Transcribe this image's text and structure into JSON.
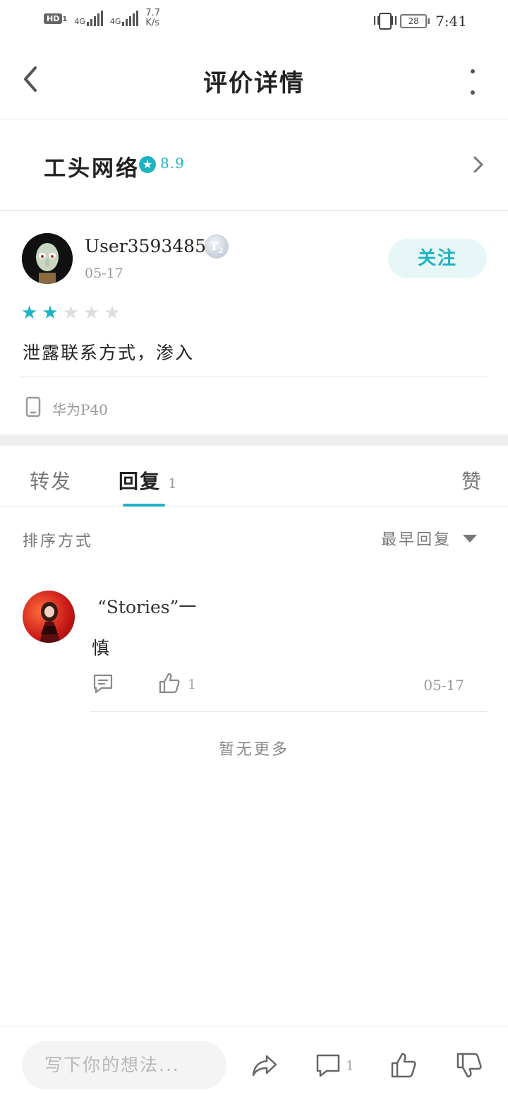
{
  "status_bar": {
    "hd": "HD",
    "hd_sub": "1",
    "net1": "4G",
    "net2": "4G",
    "speed_value": "7.7",
    "speed_unit": "K/s",
    "battery": "28",
    "time": "7:41"
  },
  "header": {
    "title": "评价详情"
  },
  "app": {
    "name": "工头网络",
    "score": "8.9"
  },
  "review": {
    "username": "User35934854",
    "level": "T",
    "level_sub": "2",
    "date": "05-17",
    "follow_label": "关注",
    "stars_filled": 2,
    "stars_total": 5,
    "text": "泄露联系方式，渗入",
    "device": "华为P40"
  },
  "tabs": {
    "forward": "转发",
    "reply": "回复",
    "reply_count": "1",
    "like": "赞"
  },
  "sort": {
    "label": "排序方式",
    "selected": "最早回复"
  },
  "reply": {
    "name": "“Stories”一",
    "text": "慎",
    "like_count": "1",
    "date": "05-17"
  },
  "no_more": "暂无更多",
  "bottom_bar": {
    "placeholder": "写下你的想法...",
    "comment_count": "1"
  },
  "colors": {
    "accent": "#1eb3c2",
    "accent_light": "#e7f7f8",
    "star_off": "#dddddd"
  }
}
